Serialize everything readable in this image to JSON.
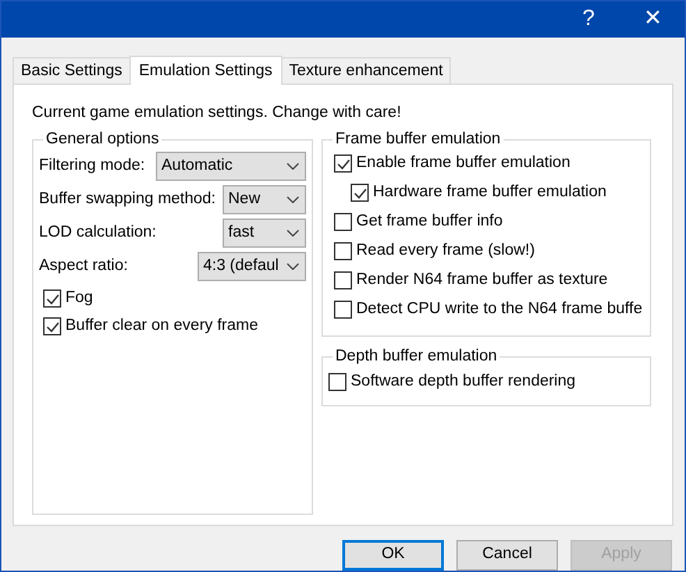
{
  "window": {
    "title_buttons": [
      "?",
      "✕"
    ]
  },
  "tabs": [
    {
      "label": "Basic Settings",
      "selected": false
    },
    {
      "label": "Emulation Settings",
      "selected": true
    },
    {
      "label": "Texture enhancement",
      "selected": false
    }
  ],
  "intro": "Current game emulation settings. Change with care!",
  "general_options": {
    "title": "General options",
    "fields": [
      {
        "kind": "select",
        "label": "Filtering mode:",
        "value": "Automatic"
      },
      {
        "kind": "select",
        "label": "Buffer swapping method:",
        "value": "New"
      },
      {
        "kind": "select",
        "label": "LOD calculation:",
        "value": "fast"
      },
      {
        "kind": "select",
        "label": "Aspect ratio:",
        "value": "4:3 (defaul"
      },
      {
        "kind": "checkbox",
        "label": "Fog",
        "checked": true
      },
      {
        "kind": "checkbox",
        "label": "Buffer clear on every frame",
        "checked": true
      }
    ]
  },
  "frame_buffer_emulation": {
    "title": "Frame buffer emulation",
    "options": [
      {
        "label": "Enable frame buffer emulation",
        "checked": true,
        "children": [
          {
            "label": "Hardware frame buffer emulation",
            "checked": true
          }
        ]
      },
      {
        "label": "Get frame buffer info",
        "checked": false
      },
      {
        "label": "Read every frame (slow!)",
        "checked": false
      },
      {
        "label": "Render N64 frame buffer as texture",
        "checked": false
      },
      {
        "label": "Detect CPU write to the N64 frame buffe",
        "checked": false
      }
    ]
  },
  "depth_buffer_emulation": {
    "title": "Depth buffer emulation",
    "options": [
      {
        "label": "Software depth buffer rendering",
        "checked": false
      }
    ]
  },
  "buttons": [
    {
      "label": "OK",
      "default": true,
      "disabled": false
    },
    {
      "label": "Cancel",
      "default": false,
      "disabled": false
    },
    {
      "label": "Apply",
      "default": false,
      "disabled": true
    }
  ]
}
